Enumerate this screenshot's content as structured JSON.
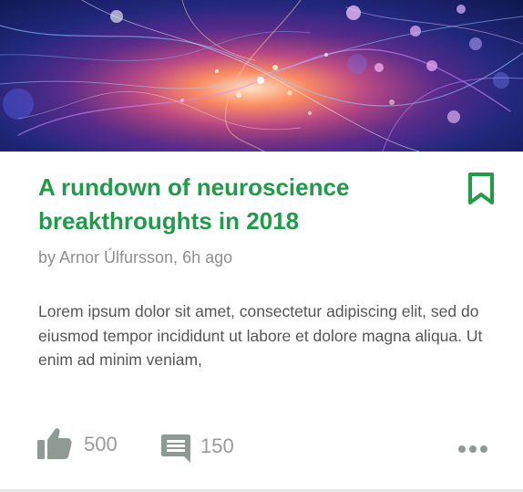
{
  "article": {
    "image_alt": "",
    "title": "A rundown of neuroscience breakthroughts in 2018",
    "author": "Arnor Úlfursson",
    "byline": "by Arnor Úlfursson, 6h ago",
    "time_ago": "6h ago",
    "excerpt": "Lorem ipsum dolor sit amet, consectetur adipiscing elit, sed do eiusmod tempor incididunt ut labore et dolore magna aliqua. Ut enim ad minim veniam,"
  },
  "actions": {
    "likes": "500",
    "comments": "150"
  },
  "icons": {
    "bookmark": "bookmark-icon",
    "like": "thumbs-up-icon",
    "comment": "comment-icon",
    "more": "more-dots-icon"
  },
  "colors": {
    "accent": "#1f9b4a",
    "icon_gray": "#8f9a95",
    "text_muted": "#8f8f8f",
    "body_text": "#555555"
  }
}
